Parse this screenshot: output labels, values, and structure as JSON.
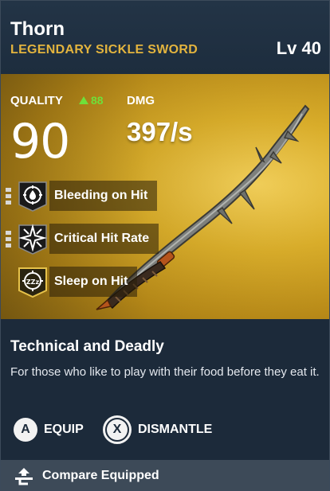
{
  "item": {
    "name": "Thorn",
    "type": "LEGENDARY SICKLE SWORD",
    "level": "Lv 40"
  },
  "stats": {
    "quality_label": "QUALITY",
    "quality_delta": "88",
    "quality_value": "90",
    "dmg_label": "DMG",
    "dmg_value": "397/s"
  },
  "perks": [
    {
      "label": "Bleeding on Hit",
      "icon": "blood-drop-target-icon",
      "pips_filled": 0,
      "pips_total": 3
    },
    {
      "label": "Critical Hit Rate",
      "icon": "critical-burst-icon",
      "pips_filled": 0,
      "pips_total": 3
    },
    {
      "label": "Sleep on Hit",
      "icon": "sleep-target-icon",
      "pips_filled": 0,
      "pips_total": 0
    }
  ],
  "description": {
    "title": "Technical and Deadly",
    "text": "For those who like to play with their food before they eat it."
  },
  "actions": {
    "equip_key": "A",
    "equip_label": "EQUIP",
    "dismantle_key": "X",
    "dismantle_label": "DISMANTLE"
  },
  "footer": {
    "compare_label": "Compare Equipped",
    "compare_icon": "compare-arrow-icon"
  },
  "colors": {
    "accent_gold": "#e3b43e",
    "quality_up": "#6fe03a",
    "panel_bg": "#1c2a3a",
    "footer_bg": "#3d4a58"
  }
}
